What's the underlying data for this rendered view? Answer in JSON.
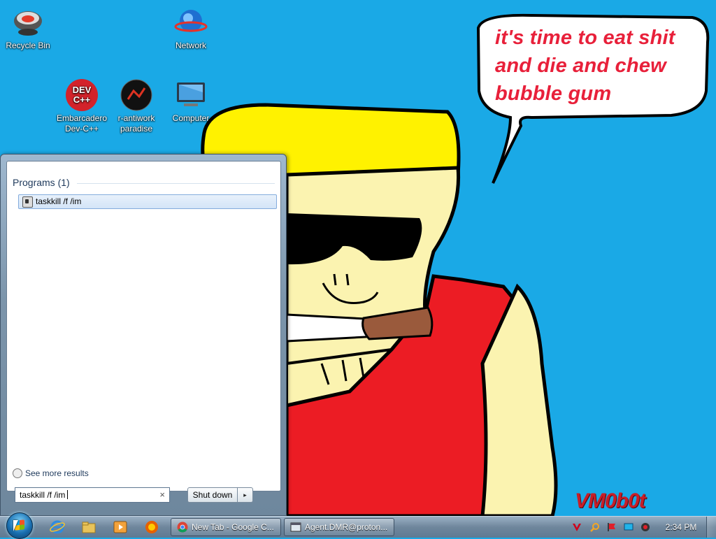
{
  "desktop": {
    "icons": [
      {
        "label": "Recycle Bin"
      },
      {
        "label": "Network"
      },
      {
        "label": "Embarcadero Dev-C++"
      },
      {
        "label": "r-antiwork paradise"
      },
      {
        "label": "Computer"
      }
    ],
    "devcpp_icon_text": "DEV C++",
    "wallpaper": {
      "speech_lines": [
        "it's time to eat shit",
        "and die and chew",
        "bubble gum"
      ],
      "logo": "VM0b0t"
    }
  },
  "start_menu": {
    "group_header": "Programs (1)",
    "results": [
      {
        "label": "taskkill /f /im"
      }
    ],
    "see_more": "See more results",
    "search": {
      "value": "taskkill /f /im"
    },
    "shutdown_label": "Shut down",
    "shutdown_arrow": "▸"
  },
  "taskbar": {
    "tasks": [
      {
        "label": "New Tab - Google C...",
        "icon": "chrome-icon"
      },
      {
        "label": "Agent.DMR@proton...",
        "icon": "window-icon"
      }
    ],
    "pinned": [
      "internet-explorer-icon",
      "windows-explorer-icon",
      "media-player-icon",
      "firefox-icon"
    ],
    "tray": [
      "antivirus-icon",
      "search-tray-icon",
      "flag-icon",
      "display-icon",
      "volume-icon"
    ],
    "clock": "2:34 PM"
  },
  "colors": {
    "wallpaper_bg": "#1aa9e6",
    "speech_text": "#e8203a",
    "shirt": "#ec1c24",
    "hair": "#fff200",
    "skin": "#fbf3b0"
  }
}
